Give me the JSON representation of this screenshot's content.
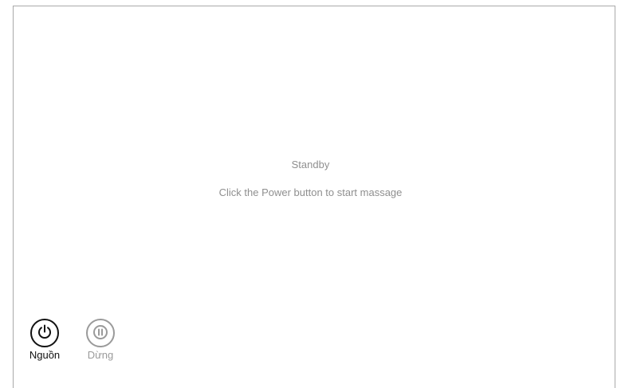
{
  "status": {
    "title": "Standby",
    "hint": "Click the Power button to start massage"
  },
  "controls": {
    "power_label": "Nguồn",
    "pause_label": "Dừng"
  },
  "colors": {
    "frame_border": "#a9a9a9",
    "status_text": "#8f8f8f",
    "power_active": "#111111",
    "pause_disabled": "#9a9a9a"
  },
  "icons": {
    "power": "power-icon",
    "pause": "pause-icon"
  }
}
